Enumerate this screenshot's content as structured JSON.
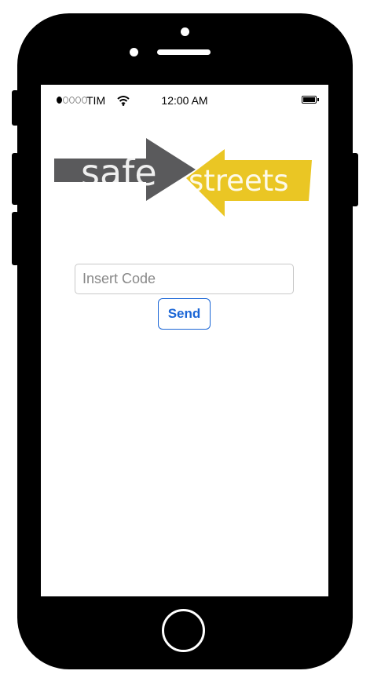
{
  "status_bar": {
    "signal_bars_filled": 1,
    "signal_bars_total": 5,
    "carrier": "TIM",
    "wifi_icon": "wifi-icon",
    "time": "12:00 AM",
    "battery_icon": "battery-icon",
    "battery_level": 1.0
  },
  "logo": {
    "word_left": "safe",
    "word_right": "streets",
    "left_arrow_color": "#5a5a5c",
    "right_arrow_color": "#eac624"
  },
  "form": {
    "code_placeholder": "Insert Code",
    "code_value": "",
    "send_label": "Send",
    "accent": "#1b66d6"
  }
}
